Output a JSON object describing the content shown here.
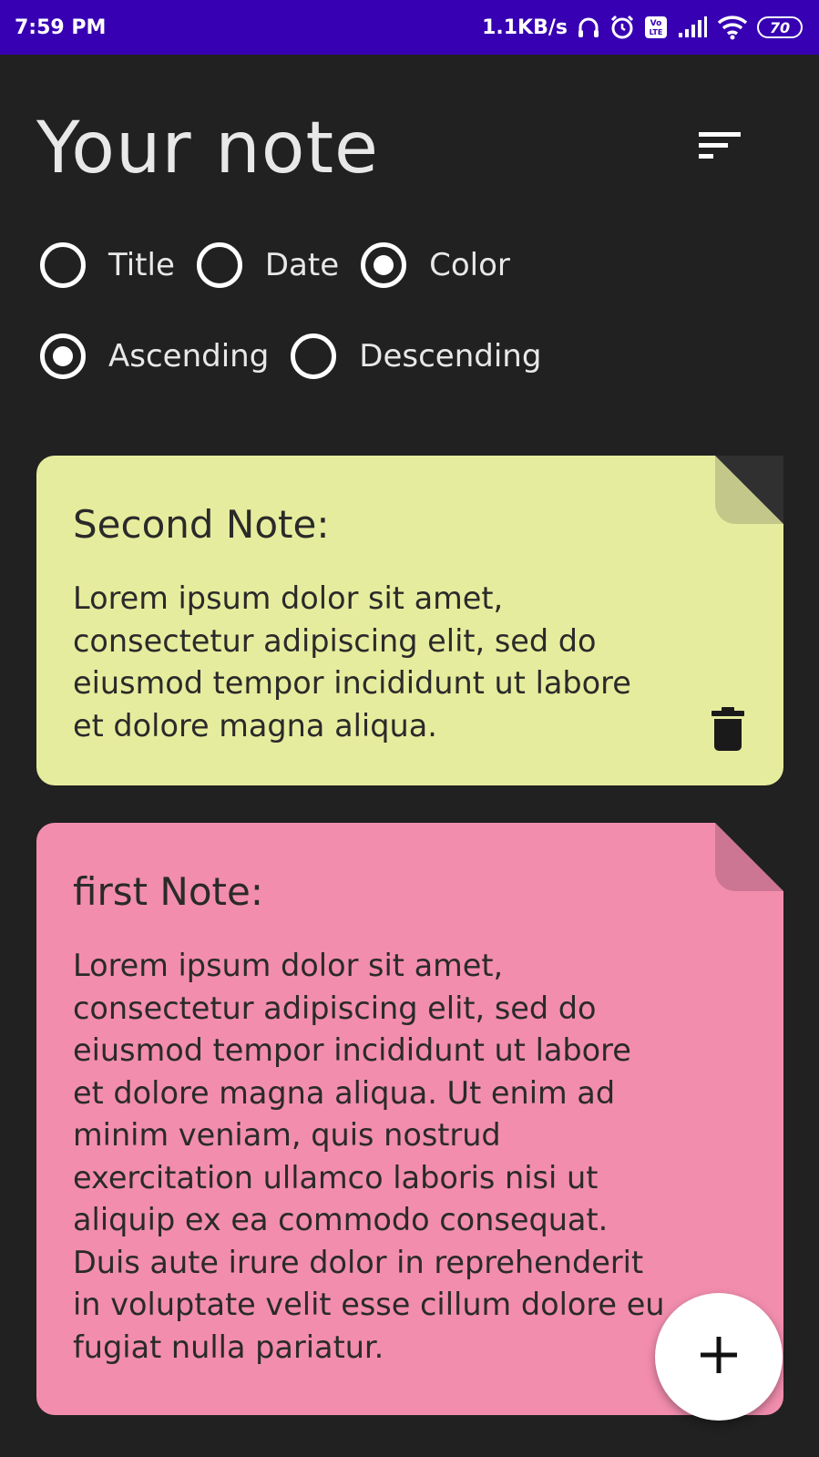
{
  "status_bar": {
    "time": "7:59 PM",
    "speed": "1.1KB/s",
    "battery": "70",
    "icons": [
      "headphones-icon",
      "alarm-icon",
      "volte-icon",
      "signal-icon",
      "wifi-icon",
      "battery-icon"
    ],
    "background": "#3700b3"
  },
  "header": {
    "title": "Your note",
    "sort_icon": "sort-icon"
  },
  "sort_by": {
    "options": [
      {
        "label": "Title",
        "selected": false
      },
      {
        "label": "Date",
        "selected": false
      },
      {
        "label": "Color",
        "selected": true
      }
    ]
  },
  "order": {
    "options": [
      {
        "label": "Ascending",
        "selected": true
      },
      {
        "label": "Descending",
        "selected": false
      }
    ]
  },
  "notes": [
    {
      "title": "Second Note:",
      "body": "Lorem ipsum dolor sit amet, consectetur adipiscing elit, sed do eiusmod tempor incididunt ut labore et dolore magna aliqua.",
      "color": "#e6ec9d",
      "action_icon": "trash-icon"
    },
    {
      "title": "first Note:",
      "body": "Lorem ipsum dolor sit amet, consectetur adipiscing elit, sed do eiusmod tempor incididunt ut labore et dolore magna aliqua. Ut enim ad minim veniam, quis nostrud exercitation ullamco laboris nisi ut aliquip ex ea commodo consequat. Duis aute irure dolor in reprehenderit in voluptate velit esse cillum dolore eu fugiat nulla pariatur.",
      "color": "#f28dae"
    }
  ],
  "fab": {
    "icon": "plus-icon"
  },
  "colors": {
    "background": "#212121",
    "fab": "#ffffff"
  }
}
